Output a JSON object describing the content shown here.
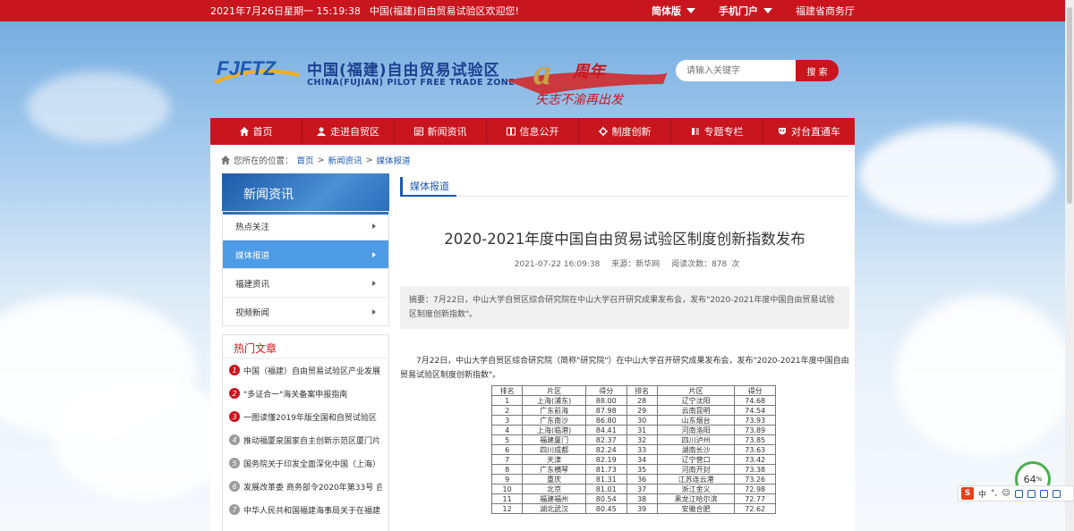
{
  "topbar": {
    "date": "2021年7月26日星期一 15:19:38",
    "welcome": "中国(福建)自由贸易试验区欢迎您!",
    "version": "简体版",
    "mobile": "手机门户",
    "dept": "福建省商务厅"
  },
  "brand": {
    "logo_text": "FJFTZ",
    "name_cn": "中国(福建)自由贸易试验区",
    "name_en": "CHINA(FUJIAN) PILOT FREE TRADE ZONE",
    "anniv_main": "周年",
    "anniv_slogan": "矢志不渝再出发"
  },
  "search": {
    "placeholder": "请输入关键字",
    "button": "搜 索"
  },
  "nav": [
    {
      "label": "首页",
      "icon": "home-icon"
    },
    {
      "label": "走进自贸区",
      "icon": "user-icon"
    },
    {
      "label": "新闻资讯",
      "icon": "news-icon"
    },
    {
      "label": "信息公开",
      "icon": "book-icon"
    },
    {
      "label": "制度创新",
      "icon": "gear-icon"
    },
    {
      "label": "专题专栏",
      "icon": "columns-icon"
    },
    {
      "label": "对台直通车",
      "icon": "mask-icon"
    }
  ],
  "breadcrumb": {
    "prefix": "您所在的位置：",
    "items": [
      "首页",
      "新闻资讯",
      "媒体报道"
    ]
  },
  "sidebar": {
    "title": "新闻资讯",
    "items": [
      "热点关注",
      "媒体报道",
      "福建资讯",
      "视频新闻"
    ],
    "active": 1
  },
  "hot": {
    "title": "热门文章",
    "items": [
      "中国（福建）自由贸易试验区产业发展",
      "\"多证合一\"海关备案申报指南",
      "一图读懂2019年版全国和自贸试验区",
      "推动福厦泉国家自主创新示范区厦门片",
      "国务院关于印发全面深化中国（上海）",
      "发展改革委 商务部令2020年第33号 自",
      "中华人民共和国福建海事局关于在福建"
    ]
  },
  "article": {
    "section": "媒体报道",
    "title": "2020-2021年度中国自由贸易试验区制度创新指数发布",
    "time": "2021-07-22 16:09:38",
    "source": "来源：新华网",
    "views": "阅读次数：878",
    "views_unit": "次",
    "abstract": "摘要：7月22日，中山大学自贸区综合研究院在中山大学召开研究成果发布会，发布\"2020-2021年度中国自由贸易试验区制度创新指数\"。",
    "para": "7月22日，中山大学自贸区综合研究院（简称\"研究院\"）在中山大学召开研究成果发布会，发布\"2020-2021年度中国自由贸易试验区制度创新指数\"。"
  },
  "ranking_table": {
    "headers": [
      "排名",
      "片区",
      "得分",
      "排名",
      "片区",
      "得分"
    ],
    "rows": [
      [
        "1",
        "上海(浦东)",
        "88.00",
        "28",
        "辽宁沈阳",
        "74.68"
      ],
      [
        "2",
        "广东前海",
        "87.98",
        "29",
        "云南昆明",
        "74.54"
      ],
      [
        "3",
        "广东南沙",
        "86.80",
        "30",
        "山东烟台",
        "73.93"
      ],
      [
        "4",
        "上海(临港)",
        "84.41",
        "31",
        "河南洛阳",
        "73.89"
      ],
      [
        "5",
        "福建厦门",
        "82.37",
        "32",
        "四川泸州",
        "73.85"
      ],
      [
        "6",
        "四川成都",
        "82.24",
        "33",
        "湖南长沙",
        "73.63"
      ],
      [
        "7",
        "天津",
        "82.19",
        "34",
        "辽宁营口",
        "73.42"
      ],
      [
        "8",
        "广东横琴",
        "81.73",
        "35",
        "河南开封",
        "73.38"
      ],
      [
        "9",
        "重庆",
        "81.31",
        "36",
        "江苏连云港",
        "73.26"
      ],
      [
        "10",
        "北京",
        "81.01",
        "37",
        "浙江金义",
        "72.98"
      ],
      [
        "11",
        "福建福州",
        "80.54",
        "38",
        "黑龙江哈尔滨",
        "72.77"
      ],
      [
        "12",
        "湖北武汉",
        "80.45",
        "39",
        "安徽合肥",
        "72.62"
      ]
    ]
  },
  "widgets": {
    "gauge_value": "64",
    "gauge_unit": "%",
    "ime_logo": "S",
    "ime_lang": "中"
  }
}
